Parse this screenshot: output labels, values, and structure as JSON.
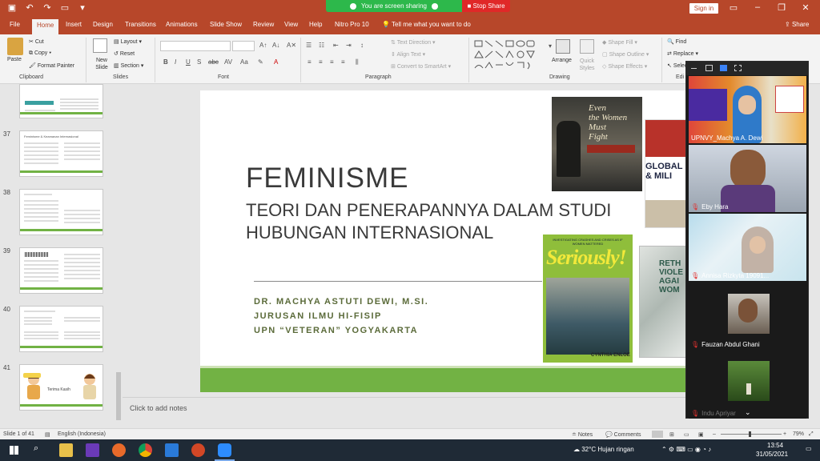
{
  "window": {
    "sharing_status": "You are screen sharing",
    "stop_share": "Stop Share",
    "sign_in": "Sign in"
  },
  "tabs": [
    "File",
    "Home",
    "Insert",
    "Design",
    "Transitions",
    "Animations",
    "Slide Show",
    "Review",
    "View",
    "Help",
    "Nitro Pro 10"
  ],
  "tell_me": "Tell me what you want to do",
  "share": "Share",
  "ribbon": {
    "paste": "Paste",
    "cut": "Cut",
    "copy": "Copy",
    "format_painter": "Format Painter",
    "new_slide": "New Slide",
    "layout": "Layout",
    "reset": "Reset",
    "section": "Section",
    "text_direction": "Text Direction",
    "align_text": "Align Text",
    "convert_smartart": "Convert to SmartArt",
    "arrange": "Arrange",
    "quick_styles": "Quick Styles",
    "shape_fill": "Shape Fill",
    "shape_outline": "Shape Outline",
    "shape_effects": "Shape Effects",
    "find": "Find",
    "replace": "Replace",
    "select": "Select",
    "groups": {
      "clipboard": "Clipboard",
      "slides": "Slides",
      "font": "Font",
      "paragraph": "Paragraph",
      "drawing": "Drawing",
      "editing": "Edi"
    }
  },
  "slides_panel": {
    "numbers": [
      "37",
      "38",
      "39",
      "40",
      "41"
    ],
    "thumb37_title": "Feminisme & Keamanan Internasional",
    "thumb41_text": "Terima Kasih"
  },
  "slide": {
    "title": "FEMINISME",
    "subtitle": "TEORI DAN PENERAPANNYA DALAM STUDI HUBUNGAN INTERNASIONAL",
    "author_line1": "DR. MACHYA ASTUTI DEWI, M.SI.",
    "author_line2": "JURUSAN ILMU HI-FISIP",
    "author_line3": "UPN “VETERAN” YOGYAKARTA",
    "book1": {
      "title_a": "Even",
      "title_b": "the Women",
      "title_c": "Must",
      "title_d": "Fight"
    },
    "book2": {
      "title_a": "GLOBAL",
      "title_b": "& MILI"
    },
    "book3": {
      "kicker": "INVESTIGATING CRASHES AND CRISES AS IF WOMEN MATTERED",
      "title": "Seriously!",
      "author": "CYNTHIA ENLOE"
    },
    "book4": {
      "title_a": "RETH",
      "title_b": "VIOLE",
      "title_c": "AGAI",
      "title_d": "WOM"
    }
  },
  "notes_placeholder": "Click to add notes",
  "zoom": {
    "participants": [
      {
        "name": "UPNVY_Machya A. Dewi",
        "muted": false
      },
      {
        "name": "Eby Hara",
        "muted": true
      },
      {
        "name": "Annisa Rizkyta 19091...",
        "muted": true
      },
      {
        "name": "Fauzan Abdul Ghani",
        "muted": true
      },
      {
        "name": "Indu Apriyar",
        "muted": true
      }
    ]
  },
  "status": {
    "slide_of": "Slide 1 of 41",
    "language": "English (Indonesia)",
    "notes": "Notes",
    "comments": "Comments",
    "zoom": "79%"
  },
  "taskbar": {
    "weather": "32°C  Hujan ringan",
    "time": "13:54",
    "date": "31/05/2021"
  },
  "colors": {
    "accent": "#b7472a",
    "slide_green": "#72b244",
    "share_green": "#2db84b",
    "stop_red": "#e02828"
  }
}
